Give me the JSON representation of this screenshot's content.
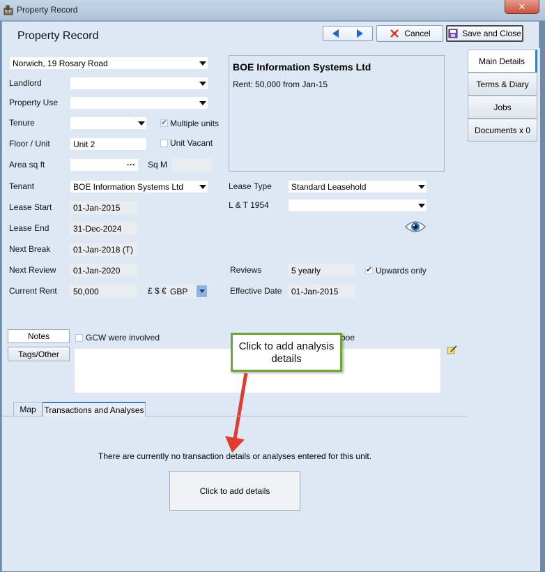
{
  "window": {
    "title": "Property Record",
    "close_symbol": "✕"
  },
  "header": {
    "page_title": "Property Record",
    "cancel_label": "Cancel",
    "save_close_label": "Save and Close"
  },
  "property_select": {
    "value": "Norwich, 19 Rosary Road"
  },
  "form": {
    "landlord": {
      "label": "Landlord",
      "value": ""
    },
    "property_use": {
      "label": "Property Use",
      "value": ""
    },
    "tenure": {
      "label": "Tenure",
      "value": ""
    },
    "multiple_units": {
      "label": "Multiple units",
      "checked": true
    },
    "floor_unit": {
      "label": "Floor / Unit",
      "value": "Unit 2"
    },
    "unit_vacant": {
      "label": "Unit Vacant",
      "checked": false
    },
    "area": {
      "label": "Area sq ft",
      "value": "",
      "ellipsis": "···"
    },
    "sqm": {
      "label": "Sq M",
      "value": ""
    },
    "tenant": {
      "label": "Tenant",
      "value": "BOE Information Systems Ltd"
    },
    "lease_type": {
      "label": "Lease Type",
      "value": "Standard Leasehold"
    },
    "lease_start": {
      "label": "Lease Start",
      "value": "01-Jan-2015"
    },
    "lt1954": {
      "label": "L & T 1954",
      "value": ""
    },
    "lease_end": {
      "label": "Lease End",
      "value": "31-Dec-2024"
    },
    "next_break": {
      "label": "Next Break",
      "value": "01-Jan-2018 (T)"
    },
    "next_review": {
      "label": "Next Review",
      "value": "01-Jan-2020"
    },
    "reviews": {
      "label": "Reviews",
      "value": "5 yearly"
    },
    "upwards_only": {
      "label": "Upwards only",
      "checked": true
    },
    "current_rent": {
      "label": "Current Rent",
      "value": "50,000"
    },
    "currency": {
      "label": "£ $ €",
      "value": "GBP"
    },
    "effective_date": {
      "label": "Effective Date",
      "value": "01-Jan-2015"
    }
  },
  "infobox": {
    "title": "BOE Information Systems Ltd",
    "rent_line": "Rent: 50,000 from Jan-15"
  },
  "notes_section": {
    "notes_tab": "Notes",
    "tags_tab": "Tags/Other",
    "gcw_label": "GCW were involved",
    "gcw_checked": false,
    "partial_label": "boe"
  },
  "callout": {
    "text": "Click to add analysis details"
  },
  "bottom_tabs": [
    {
      "label": "Map"
    },
    {
      "label": "Transactions and Analyses"
    }
  ],
  "transactions": {
    "empty_message": "There are currently no transaction details or analyses entered for this unit.",
    "add_button": "Click to add details"
  },
  "side_tabs": [
    {
      "label": "Main Details"
    },
    {
      "label": "Terms & Diary"
    },
    {
      "label": "Jobs"
    },
    {
      "label": "Documents x 0"
    }
  ],
  "colors": {
    "accent_blue": "#1e64c8",
    "callout_border": "#6ea536",
    "arrow_red": "#e03c31",
    "cancel_red": "#d93a2a"
  }
}
